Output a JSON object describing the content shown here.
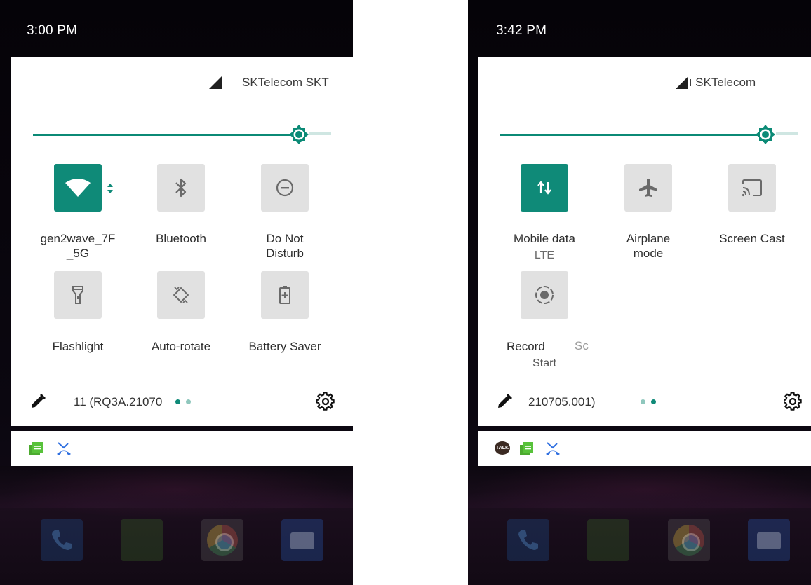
{
  "left": {
    "time": "3:00 PM",
    "carrier": "SKTelecom SKT",
    "tiles": [
      {
        "label": "gen2wave_7F\n_5G",
        "icon": "wifi-icon",
        "active": true
      },
      {
        "label": "Bluetooth",
        "icon": "bluetooth-icon",
        "active": false
      },
      {
        "label": "Do Not\nDisturb",
        "icon": "do-not-disturb-icon",
        "active": false
      },
      {
        "label": "Flashlight",
        "icon": "flashlight-icon",
        "active": false
      },
      {
        "label": "Auto-rotate",
        "icon": "auto-rotate-icon",
        "active": false
      },
      {
        "label": "Battery Saver",
        "icon": "battery-saver-icon",
        "active": false
      }
    ],
    "build": "11 (RQ3A.21070",
    "page": 1
  },
  "right": {
    "time": "3:42 PM",
    "carrier": "ו SKTelecom",
    "tiles": [
      {
        "label": "Mobile data",
        "sub": "LTE",
        "icon": "mobile-data-icon",
        "active": true
      },
      {
        "label": "Airplane\nmode",
        "icon": "airplane-icon",
        "active": false
      },
      {
        "label": "Screen Cast",
        "icon": "screen-cast-icon",
        "active": false
      },
      {
        "label": "Record",
        "sub": "Start",
        "icon": "screen-record-icon",
        "active": false
      }
    ],
    "clipped_label": "Sc",
    "build": "210705.001)",
    "page": 2
  },
  "colors": {
    "accent": "#0f8a78",
    "tile_off": "#e1e1e1"
  },
  "notifications_left": [
    "messages-icon",
    "missed-call-icon"
  ],
  "notifications_right": [
    "kakaotalk-icon",
    "messages-icon",
    "missed-call-icon"
  ],
  "talk_badge": "TALK",
  "dock": [
    "phone-icon",
    "messages-icon",
    "chrome-icon",
    "camera-icon"
  ]
}
